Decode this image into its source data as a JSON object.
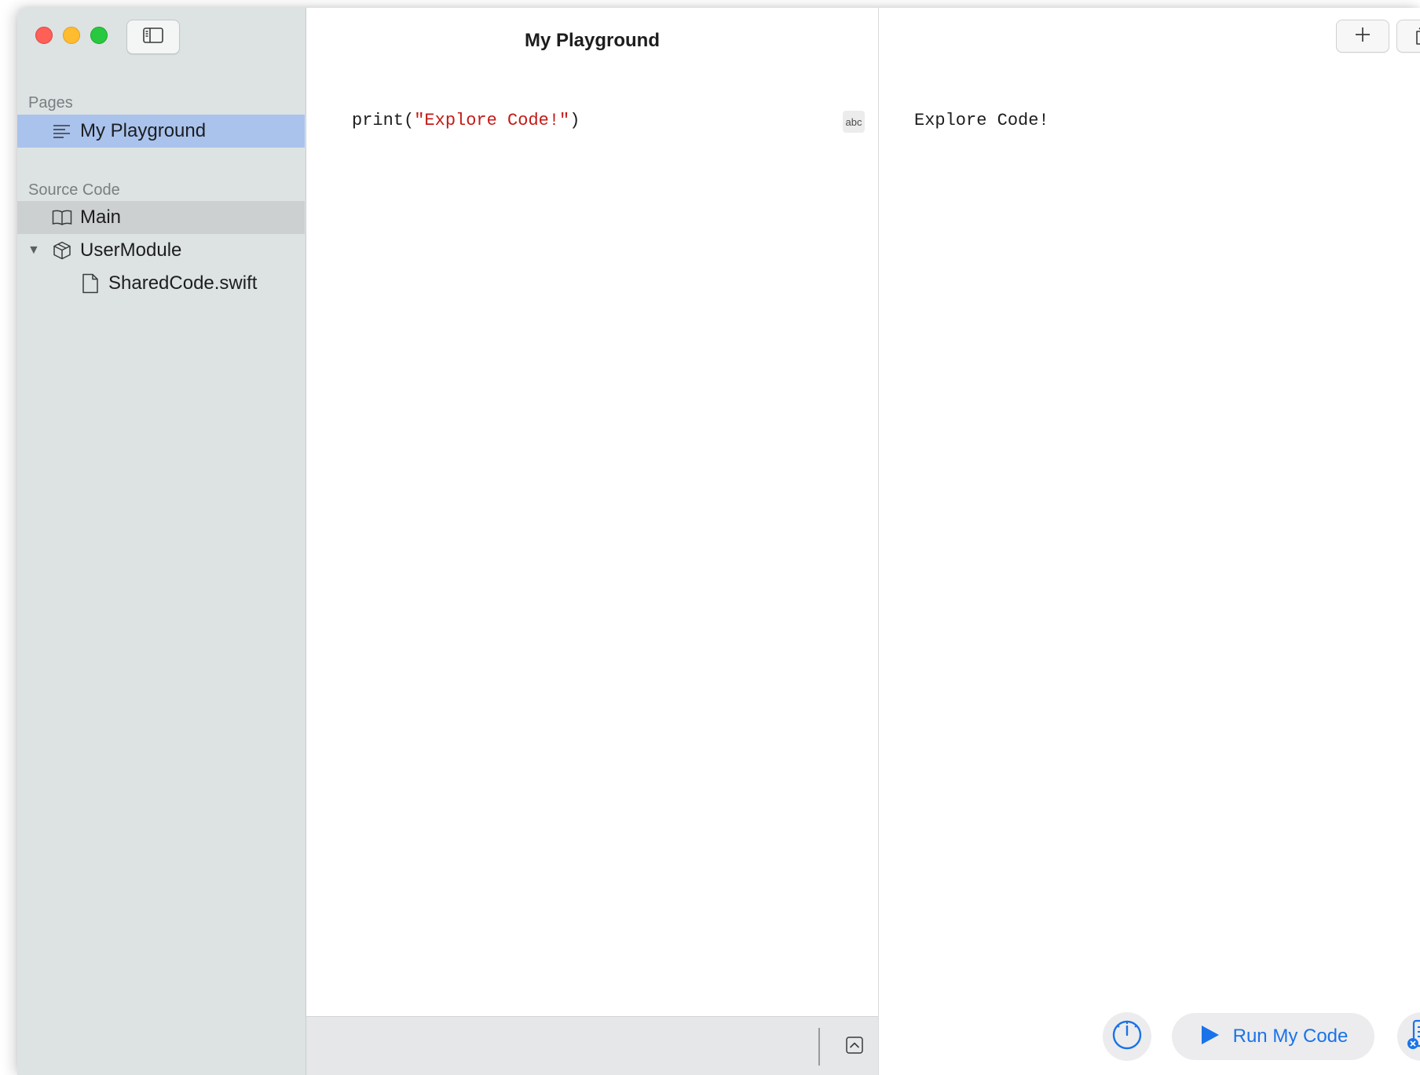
{
  "window": {
    "title": "My Playground"
  },
  "sidebar": {
    "pages_header": "Pages",
    "pages": [
      {
        "label": "My Playground",
        "icon": "lines-page-icon",
        "selected": true
      }
    ],
    "source_header": "Source Code",
    "source_items": [
      {
        "label": "Main",
        "icon": "book-icon"
      },
      {
        "label": "UserModule",
        "icon": "cube-icon",
        "expanded": true
      },
      {
        "label": "SharedCode.swift",
        "icon": "document-icon"
      }
    ]
  },
  "editor": {
    "code": {
      "prefix": "print(",
      "string": "\"Explore Code!\"",
      "suffix": ")"
    },
    "result_badge": "abc"
  },
  "liveview": {
    "output": "Explore Code!",
    "run_button": "Run My Code"
  },
  "colors": {
    "accent": "#1a73e8",
    "selection": "#a9c3ed",
    "string_literal": "#c41a16"
  }
}
